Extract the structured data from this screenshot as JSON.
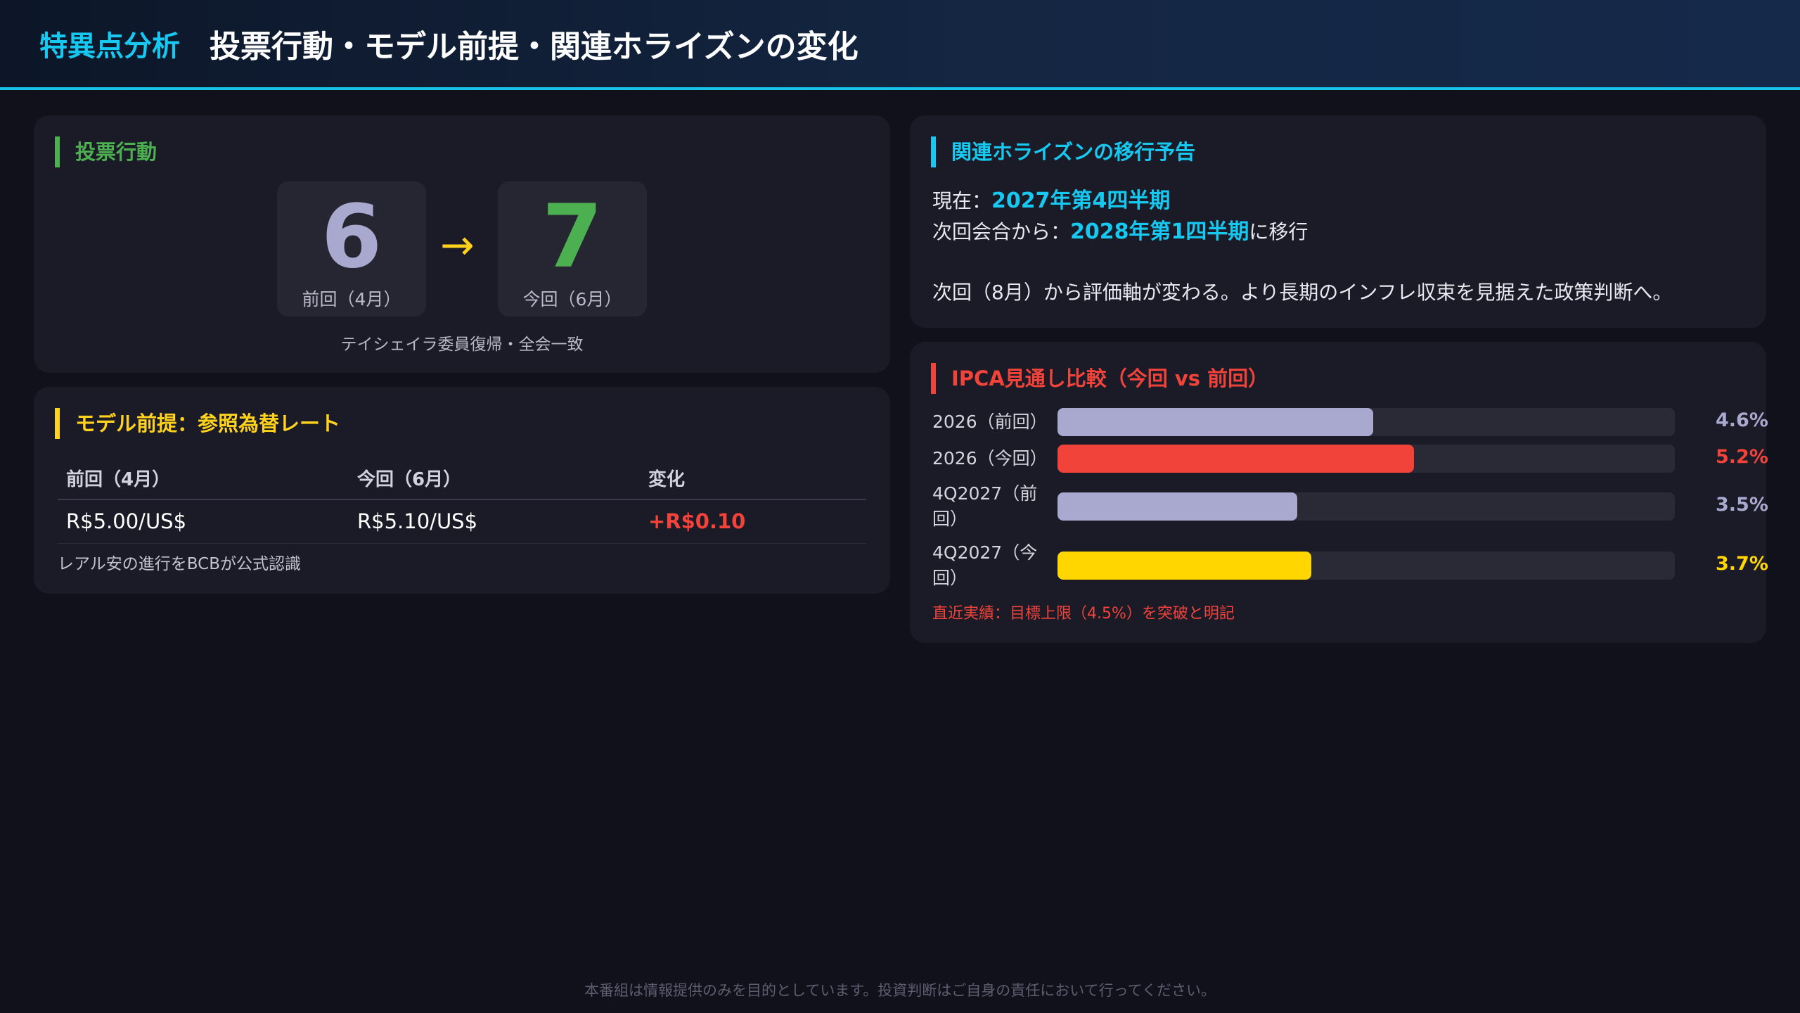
{
  "header": {
    "tag": "特異点分析",
    "title": "投票行動・モデル前提・関連ホライズンの変化"
  },
  "vote": {
    "title": "投票行動",
    "prev": {
      "num": "6",
      "label": "前回（4月）"
    },
    "curr": {
      "num": "7",
      "label": "今回（6月）"
    },
    "arrow": "→",
    "note": "テイシェイラ委員復帰・全会一致"
  },
  "model": {
    "title": "モデル前提：参照為替レート",
    "headers": [
      "前回（4月）",
      "今回（6月）",
      "変化"
    ],
    "row": [
      "R$5.00/US$",
      "R$5.10/US$",
      "+R$0.10"
    ],
    "note": "レアル安の進行をBCBが公式認識"
  },
  "horizon": {
    "title": "関連ホライズンの移行予告",
    "current_prefix": "現在：",
    "current_value": "2027年第4四半期",
    "next_prefix": "次回会合から：",
    "next_value": "2028年第1四半期",
    "next_suffix": "に移行",
    "note": "次回（8月）から評価軸が変わる。より長期のインフレ収束を見据えた政策判断へ。"
  },
  "ipca": {
    "title": "IPCA見通し比較（今回 vs 前回）",
    "bars": [
      {
        "label": "2026（前回）",
        "value": 4.6,
        "value_text": "4.6%",
        "color": "#a9a9cf"
      },
      {
        "label": "2026（今回）",
        "value": 5.2,
        "value_text": "5.2%",
        "color": "#f2433a"
      },
      {
        "label": "4Q2027（前回）",
        "value": 3.5,
        "value_text": "3.5%",
        "color": "#a9a9cf"
      },
      {
        "label": "4Q2027（今回）",
        "value": 3.7,
        "value_text": "3.7%",
        "color": "#ffd600"
      }
    ],
    "scale_max": 9.0,
    "note": "直近実績：目標上限（4.5%）を突破と明記"
  },
  "footer": "本番組は情報提供のみを目的としています。投資判断はご自身の責任において行ってください。",
  "colors": {
    "cyan": "#17c9f0",
    "green": "#4caf50",
    "yellow": "#ffd21e",
    "red": "#f2433a",
    "lavender": "#a9a9cf"
  }
}
